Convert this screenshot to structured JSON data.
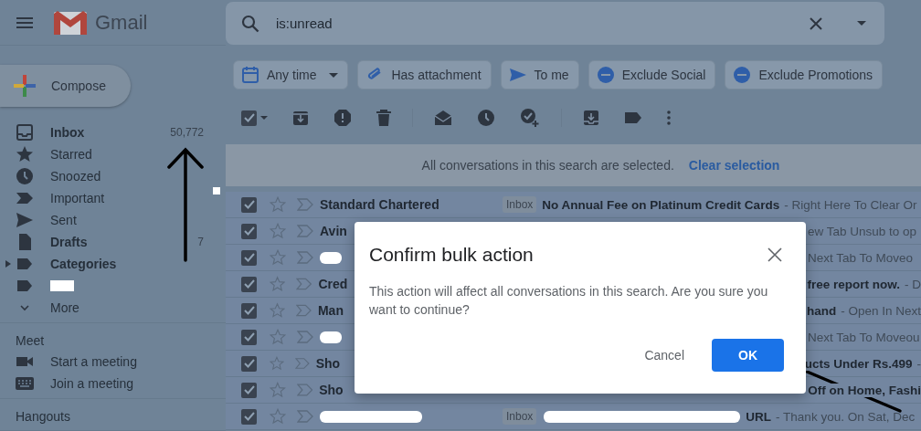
{
  "header": {
    "app_name": "Gmail"
  },
  "search": {
    "value": "is:unread"
  },
  "compose": {
    "label": "Compose"
  },
  "sidebar": {
    "items": [
      {
        "label": "Inbox",
        "bold": true,
        "count": "50,772",
        "redacted": false
      },
      {
        "label": "Starred",
        "bold": false,
        "redacted": false
      },
      {
        "label": "Snoozed",
        "bold": false,
        "redacted": false
      },
      {
        "label": "Important",
        "bold": false,
        "redacted": false
      },
      {
        "label": "Sent",
        "bold": false,
        "redacted": false
      },
      {
        "label": "Drafts",
        "bold": true,
        "count": "7",
        "redacted": false
      },
      {
        "label": "Categories",
        "bold": true,
        "expanded": false,
        "redacted": false
      },
      {
        "redacted": true
      },
      {
        "label": "More",
        "bold": false,
        "redacted": false
      }
    ]
  },
  "meet": {
    "title": "Meet",
    "items": [
      {
        "label": "Start a meeting"
      },
      {
        "label": "Join a meeting"
      }
    ]
  },
  "hangouts": {
    "title": "Hangouts"
  },
  "filters": [
    {
      "label": "Any time",
      "dropdown": true
    },
    {
      "label": "Has attachment",
      "dropdown": false
    },
    {
      "label": "To me",
      "dropdown": false
    },
    {
      "label": "Exclude Social",
      "dropdown": false
    },
    {
      "label": "Exclude Promotions",
      "dropdown": false
    }
  ],
  "toolbar": {
    "select_all_checked": true
  },
  "banner": {
    "text": "All conversations in this search are selected.",
    "link": "Clear selection"
  },
  "rows": [
    {
      "kind": "full",
      "selected": true,
      "sender": "Standard Chartered",
      "sender_redacted": false,
      "label": "Inbox",
      "subject_redacted": false,
      "subject": "No Annual Fee on Platinum Credit Cards",
      "snippet": "- Right Here To Clear Or"
    },
    {
      "kind": "covered",
      "selected": true,
      "sender": "Avin",
      "sender_redacted": false,
      "snippet": "ew Tab Unsub to op"
    },
    {
      "kind": "covered",
      "selected": true,
      "sender_redacted": true,
      "snippet": "Next Tab To Moveo"
    },
    {
      "kind": "covered",
      "selected": true,
      "sender": "Cred",
      "sender_redacted": false,
      "subject": "free report now.",
      "snippet": "- D"
    },
    {
      "kind": "covered",
      "selected": true,
      "sender": "Man",
      "sender_redacted": false,
      "subject": "hand",
      "snippet": "- Open In Next"
    },
    {
      "kind": "covered",
      "selected": true,
      "sender_redacted": true,
      "snippet": "Next Tab To Moveou"
    },
    {
      "kind": "covered",
      "selected": true,
      "sender": "Sho",
      "sender_redacted": false,
      "subject": "ucts Under Rs.499",
      "snippet": "-"
    },
    {
      "kind": "covered",
      "selected": true,
      "sender": "Sho",
      "sender_redacted": false,
      "subject": "Off on Home, Fashi"
    },
    {
      "kind": "full",
      "selected": true,
      "sender_redacted": true,
      "label": "Inbox",
      "subject_redacted": true,
      "subject": "URL",
      "snippet": "- Thank you. On Sat, Dec"
    }
  ],
  "dialog": {
    "title": "Confirm bulk action",
    "body": "This action will affect all conversations in this search. Are you sure you want to continue?",
    "cancel": "Cancel",
    "ok": "OK"
  }
}
